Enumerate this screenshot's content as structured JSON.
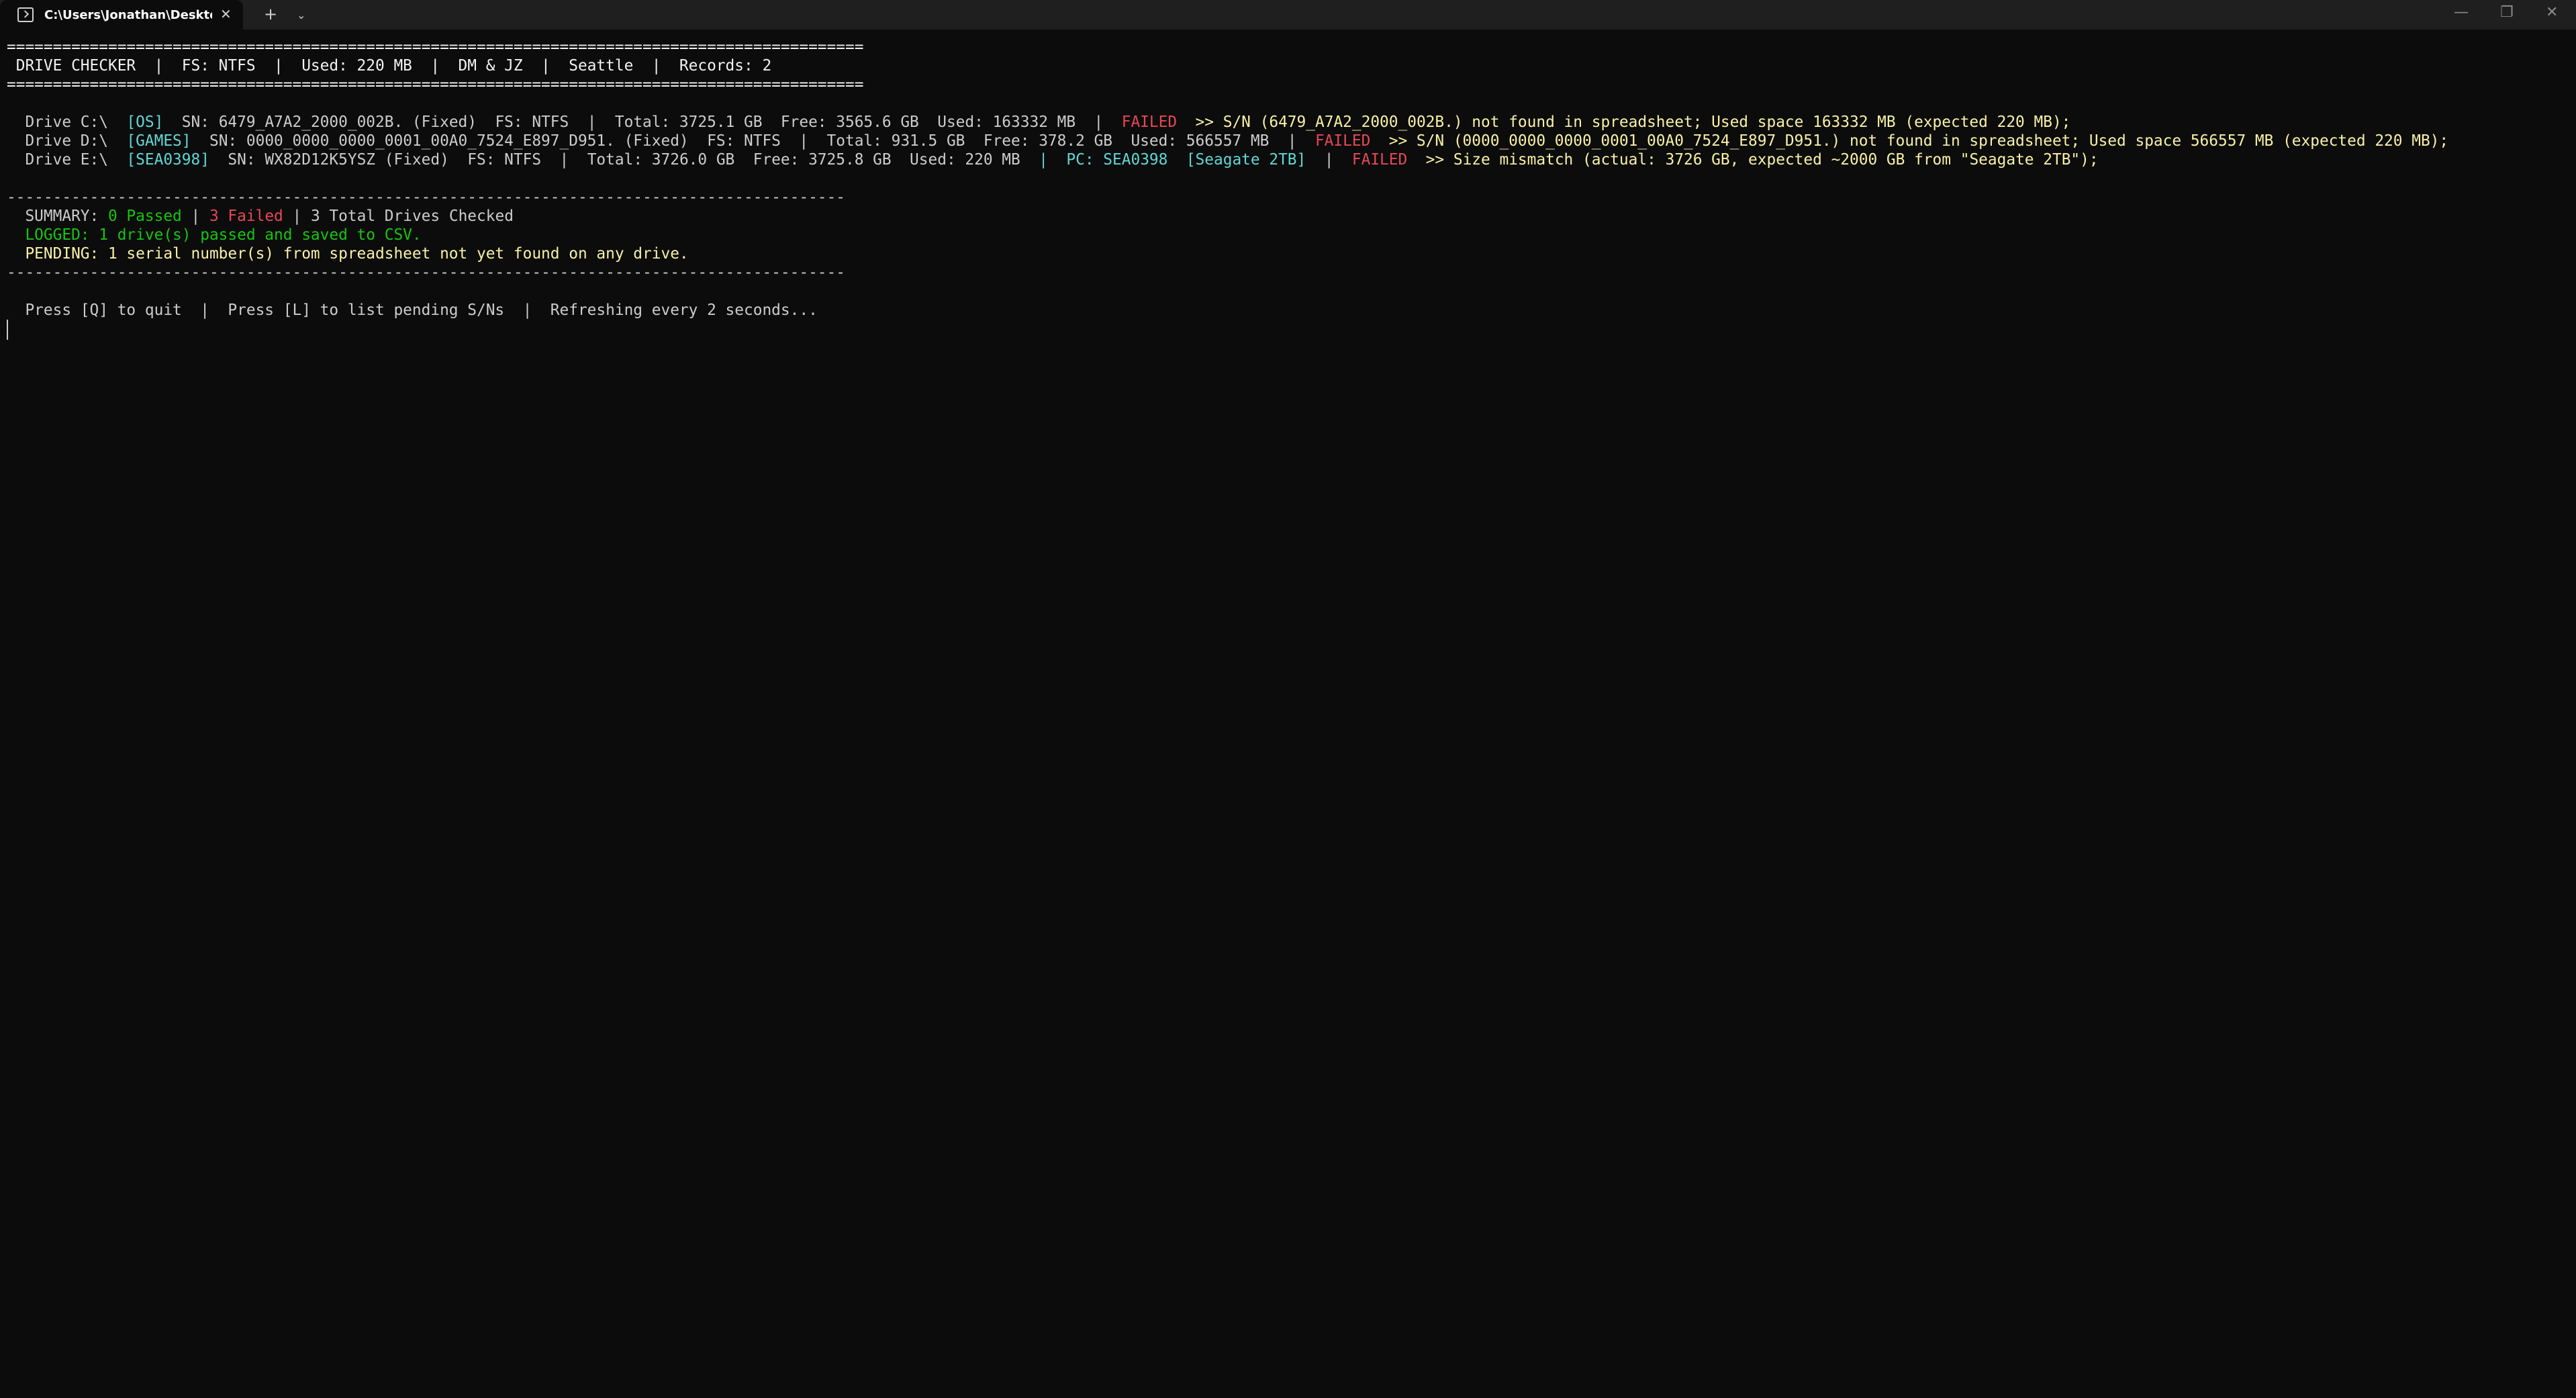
{
  "window": {
    "tab_title": "C:\\Users\\Jonathan\\Desktop\\d",
    "close_glyph": "✕",
    "new_tab_glyph": "+",
    "dropdown_glyph": "⌄",
    "min_glyph": "—",
    "max_glyph": "❐",
    "win_close_glyph": "✕"
  },
  "console": {
    "sep_eq": "=============================================================================================",
    "header": " DRIVE CHECKER  |  FS: NTFS  |  Used: 220 MB  |  DM & JZ  |  Seattle  |  Records: 2",
    "drives": [
      {
        "prefix": "  Drive C:\\  ",
        "label": "[OS]",
        "info": "  SN: 6479_A7A2_2000_002B. (Fixed)  FS: NTFS  |  Total: 3725.1 GB  Free: 3565.6 GB  Used: 163332 MB  |  ",
        "pc": "",
        "pc_label": "",
        "status": "FAILED",
        "reason": "  >> S/N (6479_A7A2_2000_002B.) not found in spreadsheet; Used space 163332 MB (expected 220 MB);"
      },
      {
        "prefix": "  Drive D:\\  ",
        "label": "[GAMES]",
        "info": "  SN: 0000_0000_0000_0001_00A0_7524_E897_D951. (Fixed)  FS: NTFS  |  Total: 931.5 GB  Free: 378.2 GB  Used: 566557 MB  |  ",
        "pc": "",
        "pc_label": "",
        "status": "FAILED",
        "reason": "  >> S/N (0000_0000_0000_0001_00A0_7524_E897_D951.) not found in spreadsheet; Used space 566557 MB (expected 220 MB);"
      },
      {
        "prefix": "  Drive E:\\  ",
        "label": "[SEA0398]",
        "info": "  SN: WX82D12K5YSZ (Fixed)  FS: NTFS  |  Total: 3726.0 GB  Free: 3725.8 GB  Used: 220 MB  ",
        "pc": "|  PC: SEA0398  [Seagate 2TB]",
        "pc_label": "  |  ",
        "status": "FAILED",
        "reason": "  >> Size mismatch (actual: 3726 GB, expected ~2000 GB from \"Seagate 2TB\");"
      }
    ],
    "sep_dash": "-------------------------------------------------------------------------------------------",
    "summary_label": "  SUMMARY: ",
    "summary_passed": "0 Passed",
    "summary_pipe1": " | ",
    "summary_failed": "3 Failed",
    "summary_total": " | 3 Total Drives Checked",
    "logged": "  LOGGED: 1 drive(s) passed and saved to CSV.",
    "pending": "  PENDING: 1 serial number(s) from spreadsheet not yet found on any drive.",
    "footer": "  Press [Q] to quit  |  Press [L] to list pending S/Ns  |  Refreshing every 2 seconds..."
  }
}
